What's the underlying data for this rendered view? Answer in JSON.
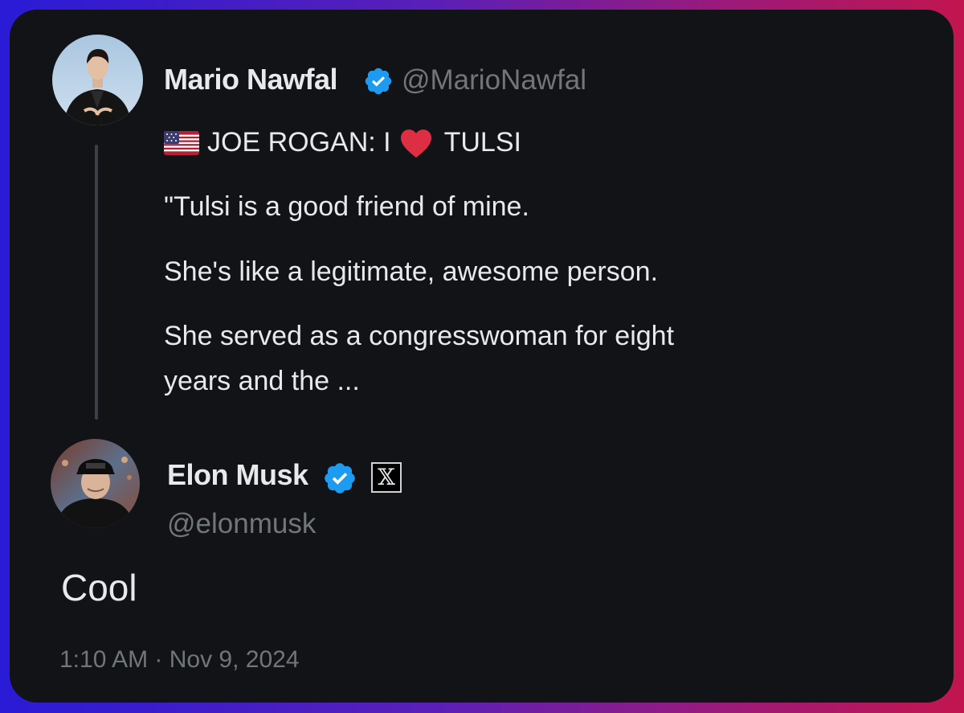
{
  "original_post": {
    "author_name": "Mario Nawfal",
    "author_handle": "@MarioNawfal",
    "headline": "JOE ROGAN: I",
    "headline_end": "TULSI",
    "flag_icon": "us-flag-icon",
    "heart_icon": "red-heart-icon",
    "lines": [
      "\"Tulsi is a good friend of mine.",
      "She's like a legitimate, awesome person.",
      "She served as a congresswoman for eight",
      "years and the ..."
    ]
  },
  "reply_post": {
    "author_name": "Elon Musk",
    "author_handle": "@elonmusk",
    "affiliate_badge": "x-logo-icon",
    "text": "Cool",
    "time": "1:10 AM",
    "separator": " · ",
    "date": "Nov 9, 2024"
  },
  "colors": {
    "card_background": "#111316",
    "verified_blue": "#1d9bf0",
    "primary_text": "#e7e9ea",
    "secondary_text": "#71767b",
    "thread_line": "#3b4046"
  }
}
